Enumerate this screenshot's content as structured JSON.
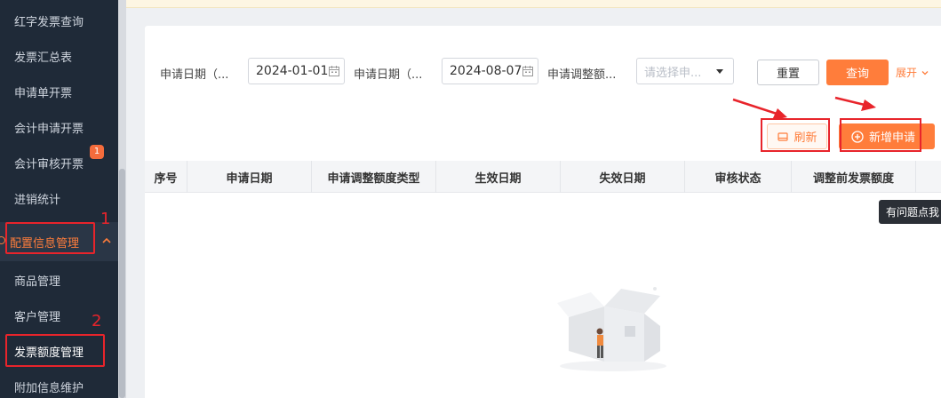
{
  "sidebar": {
    "items_top": [
      "红字发票查询",
      "发票汇总表",
      "申请单开票",
      "会计申请开票",
      "会计审核开票",
      "进销统计"
    ],
    "badge": "1",
    "parent": {
      "label": "配置信息管理"
    },
    "sub_items": [
      "商品管理",
      "客户管理",
      "发票额度管理",
      "附加信息维护"
    ]
  },
  "annotations": {
    "num1": "1",
    "num2": "2"
  },
  "filters": {
    "label1": "申请日期（...",
    "date1": "2024-01-01",
    "label2": "申请日期（...",
    "date2": "2024-08-07",
    "label3": "申请调整额...",
    "select_placeholder": "请选择申..."
  },
  "actions": {
    "reset": "重置",
    "query": "查询",
    "expand": "展开",
    "refresh": "刷新",
    "add": "新增申请"
  },
  "table": {
    "columns": [
      "序号",
      "申请日期",
      "申请调整额度类型",
      "生效日期",
      "失效日期",
      "审核状态",
      "调整前发票额度"
    ]
  },
  "tooltip": "有问题点我",
  "colors": {
    "accent": "#ff7d3b",
    "sidebar_bg": "#1f2a38",
    "annotation": "#e8242b"
  }
}
